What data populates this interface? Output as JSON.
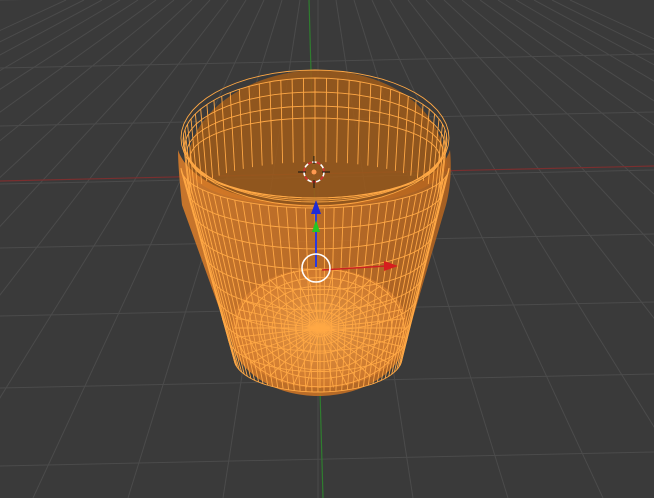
{
  "viewport": {
    "background_color": "#3a3a3a",
    "grid_line_color": "#4a4a4a",
    "x_axis_color": "#7a2a2a",
    "y_axis_color": "#2f7a2f"
  },
  "mesh": {
    "object_type": "cup-shaped mesh",
    "display_mode": "wireframe",
    "selected": true,
    "wire_color": "#ffa640",
    "face_fill_color": "#e8892d"
  },
  "gizmo": {
    "z_arrow_color": "#1e2bd6",
    "y_arrow_color": "#1ec81e",
    "x_arrow_color": "#d61e1e",
    "origin_ring_color": "#ffffff",
    "cursor_icon": "3d-cursor-icon"
  }
}
